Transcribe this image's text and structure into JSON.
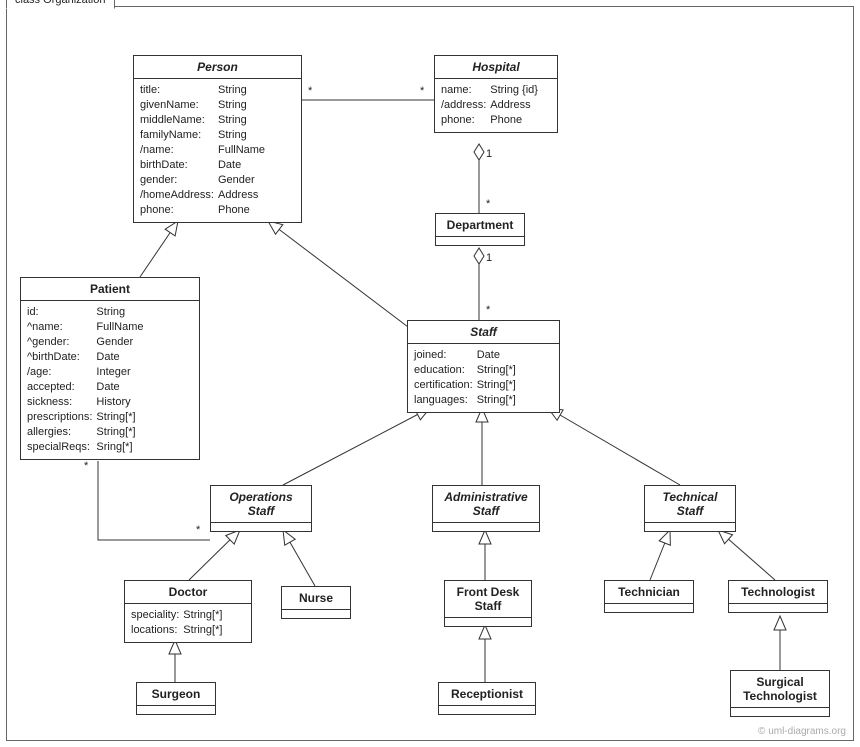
{
  "frame": {
    "title": "class Organization"
  },
  "credit": "© uml-diagrams.org",
  "classes": {
    "person": {
      "name": "Person",
      "attrs": [
        [
          "title:",
          "String"
        ],
        [
          "givenName:",
          "String"
        ],
        [
          "middleName:",
          "String"
        ],
        [
          "familyName:",
          "String"
        ],
        [
          "/name:",
          "FullName"
        ],
        [
          "birthDate:",
          "Date"
        ],
        [
          "gender:",
          "Gender"
        ],
        [
          "/homeAddress:",
          "Address"
        ],
        [
          "phone:",
          "Phone"
        ]
      ]
    },
    "hospital": {
      "name": "Hospital",
      "attrs": [
        [
          "name:",
          "String {id}"
        ],
        [
          "/address:",
          "Address"
        ],
        [
          "phone:",
          "Phone"
        ]
      ]
    },
    "department": {
      "name": "Department"
    },
    "patient": {
      "name": "Patient",
      "attrs": [
        [
          "id:",
          "String"
        ],
        [
          "^name:",
          "FullName"
        ],
        [
          "^gender:",
          "Gender"
        ],
        [
          "^birthDate:",
          "Date"
        ],
        [
          "/age:",
          "Integer"
        ],
        [
          "accepted:",
          "Date"
        ],
        [
          "sickness:",
          "History"
        ],
        [
          "prescriptions:",
          "String[*]"
        ],
        [
          "allergies:",
          "String[*]"
        ],
        [
          "specialReqs:",
          "Sring[*]"
        ]
      ]
    },
    "staff": {
      "name": "Staff",
      "attrs": [
        [
          "joined:",
          "Date"
        ],
        [
          "education:",
          "String[*]"
        ],
        [
          "certification:",
          "String[*]"
        ],
        [
          "languages:",
          "String[*]"
        ]
      ]
    },
    "operationsStaff": {
      "name1": "Operations",
      "name2": "Staff"
    },
    "administrativeStaff": {
      "name1": "Administrative",
      "name2": "Staff"
    },
    "technicalStaff": {
      "name1": "Technical",
      "name2": "Staff"
    },
    "doctor": {
      "name": "Doctor",
      "attrs": [
        [
          "speciality:",
          "String[*]"
        ],
        [
          "locations:",
          "String[*]"
        ]
      ]
    },
    "nurse": {
      "name": "Nurse"
    },
    "frontDeskStaff": {
      "name1": "Front Desk",
      "name2": "Staff"
    },
    "receptionist": {
      "name": "Receptionist"
    },
    "technician": {
      "name": "Technician"
    },
    "technologist": {
      "name": "Technologist"
    },
    "surgicalTechnologist": {
      "name1": "Surgical",
      "name2": "Technologist"
    },
    "surgeon": {
      "name": "Surgeon"
    }
  },
  "mult": {
    "personHospA": "*",
    "personHospB": "*",
    "hospDept1": "1",
    "hospDeptStar": "*",
    "deptStaff1": "1",
    "deptStaffStar": "*",
    "patOpsA": "*",
    "patOpsB": "*"
  }
}
